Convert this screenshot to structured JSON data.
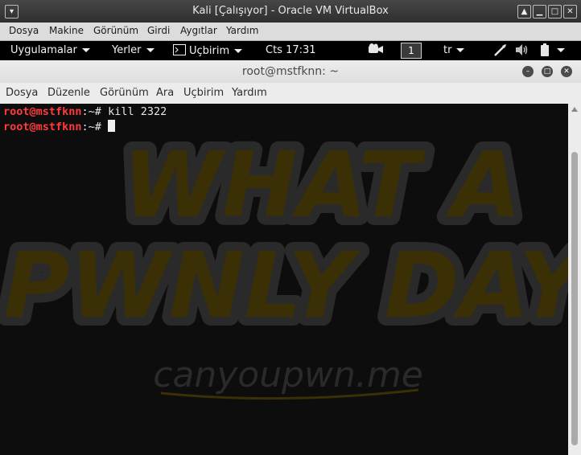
{
  "vbox": {
    "title": "Kali [Çalışıyor] - Oracle VM VirtualBox",
    "menu": [
      "Dosya",
      "Makine",
      "Görünüm",
      "Girdi",
      "Aygıtlar",
      "Yardım"
    ]
  },
  "panel": {
    "apps": "Uygulamalar",
    "places": "Yerler",
    "terminal_app": "Uçbirim",
    "clock": "Cts 17:31",
    "workspace": "1",
    "keyboard": "tr"
  },
  "terminal": {
    "title": "root@mstfknn: ~",
    "menu": [
      "Dosya",
      "Düzenle",
      "Görünüm",
      "Ara",
      "Uçbirim",
      "Yardım"
    ],
    "lines": [
      {
        "user": "root@mstfknn",
        "path": ":~#",
        "cmd": " kill 2322"
      },
      {
        "user": "root@mstfknn",
        "path": ":~#",
        "cmd": " "
      }
    ]
  },
  "wallpaper": {
    "line1": "WHAT A",
    "line2": "PWNLY DAY",
    "site": "canyoupwn.me"
  },
  "colors": {
    "prompt_user": "#ff3b3b",
    "terminal_bg": "#0d0d0d"
  }
}
